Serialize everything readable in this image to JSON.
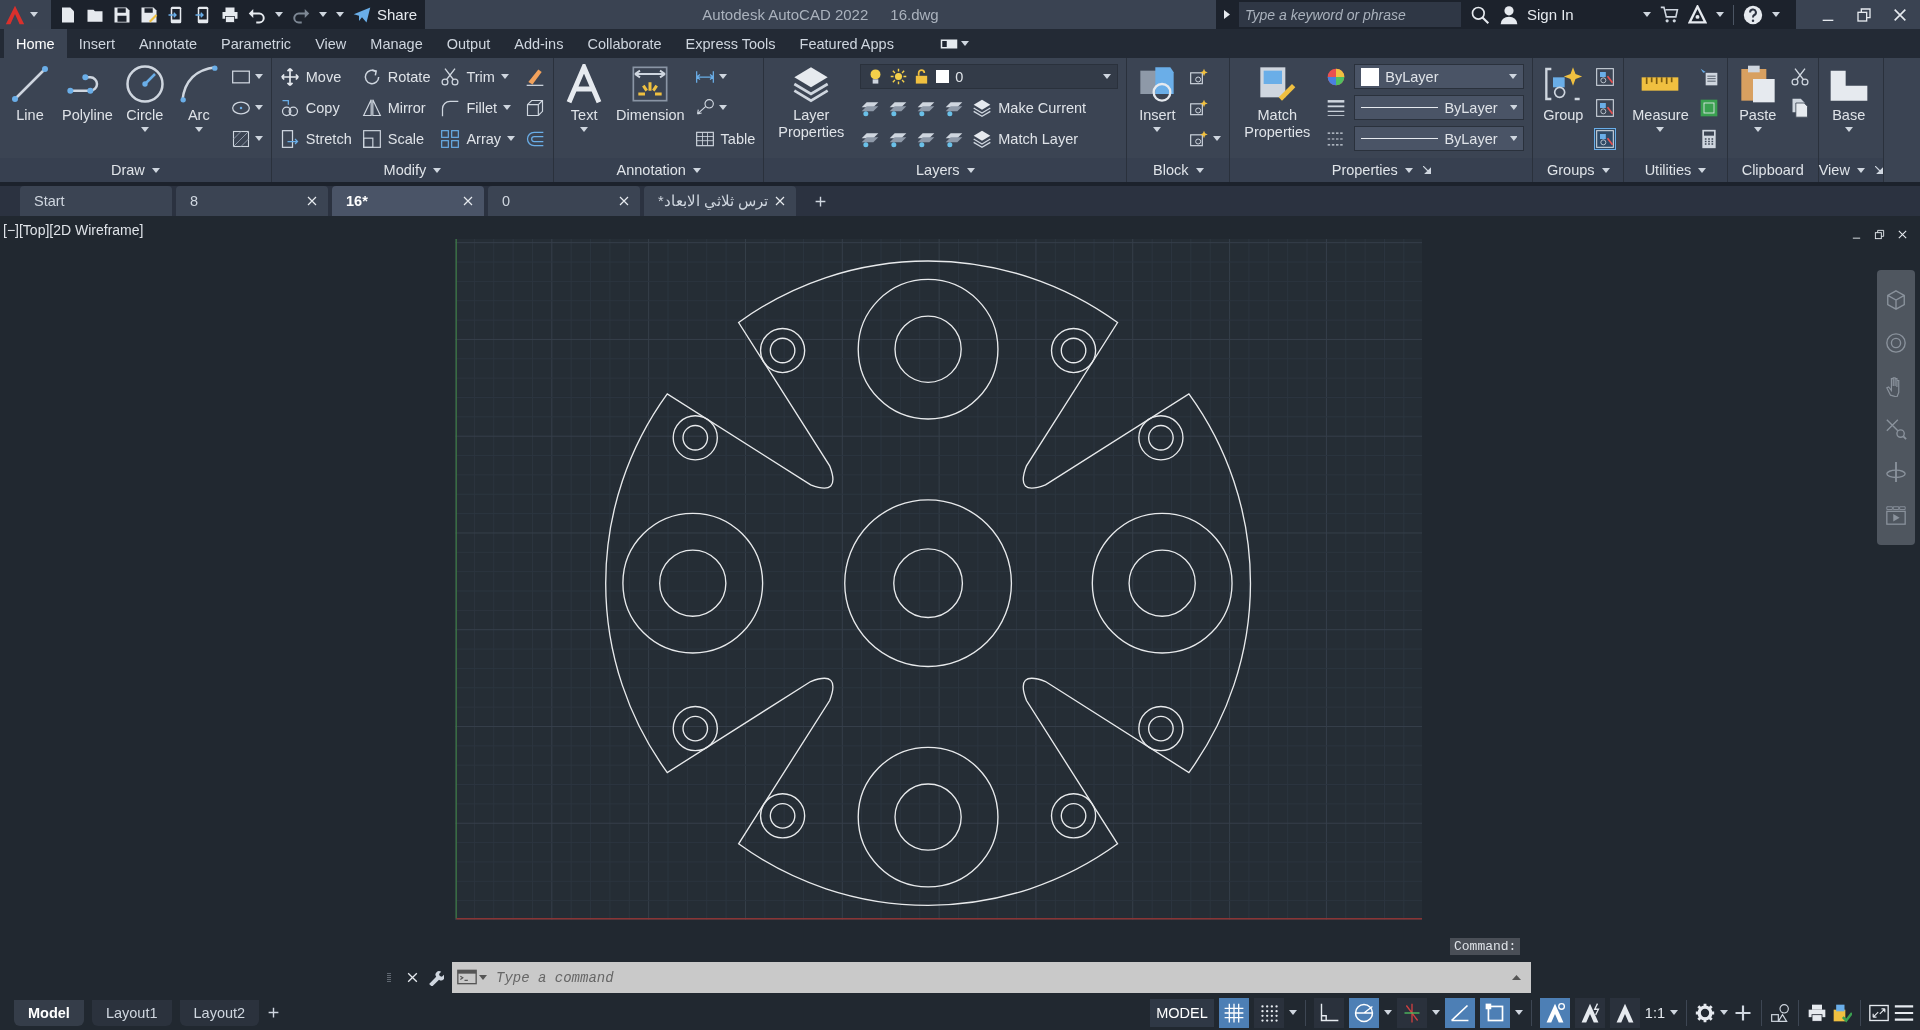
{
  "title_bar": {
    "share": "Share",
    "title": "Autodesk AutoCAD 2022",
    "file": "16.dwg",
    "search": {
      "placeholder": "Type a keyword or phrase"
    },
    "sign_in": "Sign In"
  },
  "ribbon_tabs": [
    {
      "label": "Home",
      "selected": true
    },
    {
      "label": "Insert",
      "selected": false
    },
    {
      "label": "Annotate",
      "selected": false
    },
    {
      "label": "Parametric",
      "selected": false
    },
    {
      "label": "View",
      "selected": false
    },
    {
      "label": "Manage",
      "selected": false
    },
    {
      "label": "Output",
      "selected": false
    },
    {
      "label": "Add-ins",
      "selected": false
    },
    {
      "label": "Collaborate",
      "selected": false
    },
    {
      "label": "Express Tools",
      "selected": false
    },
    {
      "label": "Featured Apps",
      "selected": false
    }
  ],
  "ribbon_panels": [
    {
      "title": "Draw",
      "title_dropdown": true,
      "launcher": false,
      "items": [
        {
          "kind": "large",
          "label": "Line",
          "dropdown": false
        },
        {
          "kind": "large",
          "label": "Polyline",
          "dropdown": false
        },
        {
          "kind": "large",
          "label": "Circle",
          "dropdown": true
        },
        {
          "kind": "large",
          "label": "Arc",
          "dropdown": true
        },
        {
          "kind": "rows",
          "rows": [
            [
              {
                "kind": "icon",
                "dropdown": true
              }
            ],
            [
              {
                "kind": "icon",
                "dropdown": true
              }
            ],
            [
              {
                "kind": "icon",
                "dropdown": true
              }
            ]
          ]
        }
      ]
    },
    {
      "title": "Modify",
      "title_dropdown": true,
      "launcher": false,
      "items": [
        {
          "kind": "rows",
          "rows": [
            [
              {
                "kind": "tool",
                "label": "Move",
                "dropdown": false
              }
            ],
            [
              {
                "kind": "tool",
                "label": "Copy",
                "dropdown": false
              }
            ],
            [
              {
                "kind": "tool",
                "label": "Stretch",
                "dropdown": false
              }
            ]
          ]
        },
        {
          "kind": "rows",
          "rows": [
            [
              {
                "kind": "tool",
                "label": "Rotate",
                "dropdown": false
              }
            ],
            [
              {
                "kind": "tool",
                "label": "Mirror",
                "dropdown": false
              }
            ],
            [
              {
                "kind": "tool",
                "label": "Scale",
                "dropdown": false
              }
            ]
          ]
        },
        {
          "kind": "rows",
          "rows": [
            [
              {
                "kind": "tool",
                "label": "Trim",
                "dropdown": true
              }
            ],
            [
              {
                "kind": "tool",
                "label": "Fillet",
                "dropdown": true
              }
            ],
            [
              {
                "kind": "tool",
                "label": "Array",
                "dropdown": true
              }
            ]
          ]
        },
        {
          "kind": "rows",
          "rows": [
            [
              {
                "kind": "icon"
              }
            ],
            [
              {
                "kind": "icon"
              }
            ],
            [
              {
                "kind": "icon"
              }
            ]
          ]
        }
      ]
    },
    {
      "title": "Annotation",
      "title_dropdown": true,
      "launcher": false,
      "items": [
        {
          "kind": "large",
          "label": "Text",
          "dropdown": true
        },
        {
          "kind": "large",
          "label": "Dimension",
          "dropdown": false
        },
        {
          "kind": "rows",
          "rows": [
            [
              {
                "kind": "icon",
                "dropdown": true
              }
            ],
            [
              {
                "kind": "icon",
                "dropdown": true
              }
            ],
            [
              {
                "kind": "tool",
                "label": "Table",
                "dropdown": false
              }
            ]
          ]
        }
      ]
    },
    {
      "title": "Layers",
      "title_dropdown": true,
      "launcher": false,
      "items": [
        {
          "kind": "large",
          "label": "Layer Properties",
          "dropdown": false
        },
        {
          "kind": "rows",
          "rows": [
            [
              {
                "kind": "layer_combo",
                "value": "0"
              }
            ],
            [
              {
                "kind": "icon"
              },
              {
                "kind": "icon"
              },
              {
                "kind": "icon"
              },
              {
                "kind": "icon"
              },
              {
                "kind": "tool",
                "label": "Make Current",
                "dropdown": false
              }
            ],
            [
              {
                "kind": "icon"
              },
              {
                "kind": "icon"
              },
              {
                "kind": "icon"
              },
              {
                "kind": "icon"
              },
              {
                "kind": "tool",
                "label": "Match Layer",
                "dropdown": false
              }
            ]
          ]
        }
      ]
    },
    {
      "title": "Block",
      "title_dropdown": true,
      "launcher": false,
      "items": [
        {
          "kind": "large",
          "label": "Insert",
          "dropdown": true
        },
        {
          "kind": "rows",
          "rows": [
            [
              {
                "kind": "icon"
              }
            ],
            [
              {
                "kind": "icon"
              }
            ],
            [
              {
                "kind": "icon",
                "dropdown": true
              }
            ]
          ]
        }
      ]
    },
    {
      "title": "Properties",
      "title_dropdown": true,
      "launcher": true,
      "items": [
        {
          "kind": "large",
          "label": "Match Properties",
          "dropdown": false
        },
        {
          "kind": "rows",
          "rows": [
            [
              {
                "kind": "icon"
              },
              {
                "kind": "color_combo",
                "value": "ByLayer"
              }
            ],
            [
              {
                "kind": "icon"
              },
              {
                "kind": "line_combo",
                "value": "ByLayer"
              }
            ],
            [
              {
                "kind": "icon"
              },
              {
                "kind": "line_combo",
                "value": "ByLayer"
              }
            ]
          ]
        }
      ]
    },
    {
      "title": "Groups",
      "title_dropdown": true,
      "launcher": false,
      "items": [
        {
          "kind": "large",
          "label": "Group",
          "dropdown": false
        },
        {
          "kind": "rows",
          "rows": [
            [
              {
                "kind": "icon",
                "on": false
              }
            ],
            [
              {
                "kind": "icon",
                "on": false
              }
            ],
            [
              {
                "kind": "icon",
                "on": true
              }
            ]
          ]
        }
      ]
    },
    {
      "title": "Utilities",
      "title_dropdown": true,
      "launcher": false,
      "items": [
        {
          "kind": "large",
          "label": "Measure",
          "dropdown": true
        },
        {
          "kind": "rows",
          "rows": [
            [
              {
                "kind": "icon"
              }
            ],
            [
              {
                "kind": "icon"
              }
            ],
            [
              {
                "kind": "icon"
              }
            ]
          ]
        }
      ]
    },
    {
      "title": "Clipboard",
      "title_dropdown": false,
      "launcher": false,
      "items": [
        {
          "kind": "large",
          "label": "Paste",
          "dropdown": true
        },
        {
          "kind": "rows",
          "rows": [
            [
              {
                "kind": "icon"
              }
            ],
            [
              {
                "kind": "icon"
              }
            ]
          ]
        }
      ]
    },
    {
      "title": "View",
      "title_dropdown": true,
      "launcher": true,
      "items": [
        {
          "kind": "large",
          "label": "Base",
          "dropdown": true
        }
      ]
    }
  ],
  "file_tabs": [
    {
      "label": "Start",
      "selected": false,
      "closable": false
    },
    {
      "label": "8",
      "selected": false,
      "closable": true
    },
    {
      "label": "16*",
      "selected": true,
      "closable": true
    },
    {
      "label": "0",
      "selected": false,
      "closable": true
    },
    {
      "label": "ترس ثلاثي الابعاد*",
      "selected": false,
      "closable": true
    }
  ],
  "viewport_label": "[−][Top][2D Wireframe]",
  "command_line": {
    "history": "Command:",
    "placeholder": "Type a command"
  },
  "layout_tabs": [
    {
      "label": "Model",
      "selected": true
    },
    {
      "label": "Layout1",
      "selected": false
    },
    {
      "label": "Layout2",
      "selected": false
    }
  ],
  "status_bar": {
    "model": "MODEL",
    "toggles": [
      {
        "on": true
      },
      {
        "on": false
      },
      {
        "on": false
      },
      {
        "on": true
      },
      {
        "on": false
      },
      {
        "on": true
      },
      {
        "on": true
      },
      {
        "on": true
      },
      {
        "on": false
      },
      {
        "on": false
      }
    ],
    "scale": "1:1"
  }
}
